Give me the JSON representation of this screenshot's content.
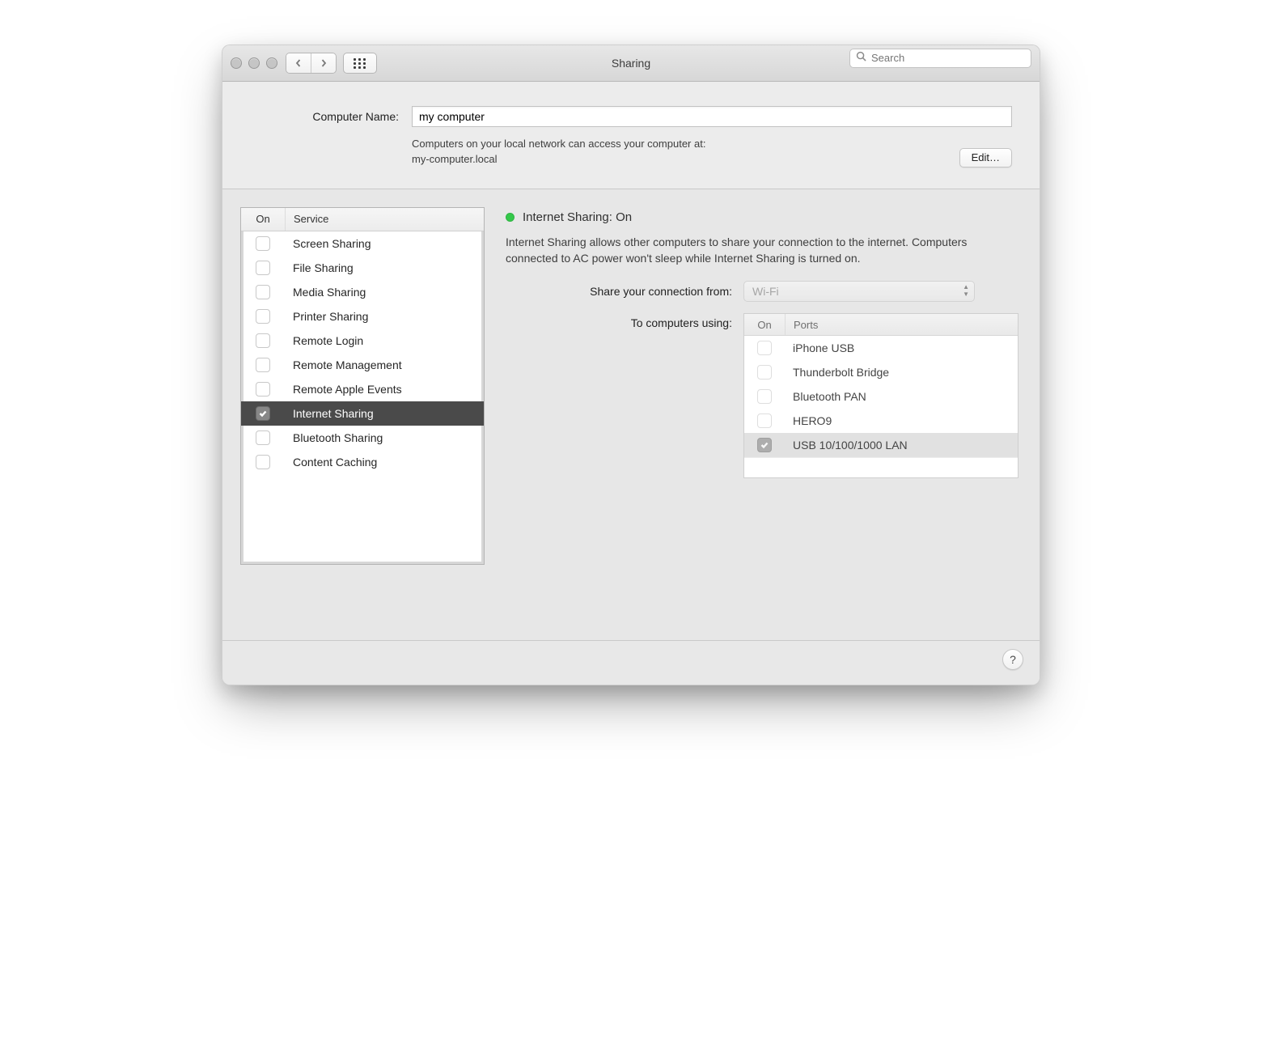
{
  "window": {
    "title": "Sharing"
  },
  "toolbar": {
    "search_placeholder": "Search"
  },
  "computerName": {
    "label": "Computer Name:",
    "value": "my computer",
    "accessLine1": "Computers on your local network can access your computer at:",
    "accessLine2": "my-computer.local",
    "editLabel": "Edit…"
  },
  "servicesHeader": {
    "on": "On",
    "service": "Service"
  },
  "services": [
    {
      "label": "Screen Sharing",
      "on": false,
      "selected": false
    },
    {
      "label": "File Sharing",
      "on": false,
      "selected": false
    },
    {
      "label": "Media Sharing",
      "on": false,
      "selected": false
    },
    {
      "label": "Printer Sharing",
      "on": false,
      "selected": false
    },
    {
      "label": "Remote Login",
      "on": false,
      "selected": false
    },
    {
      "label": "Remote Management",
      "on": false,
      "selected": false
    },
    {
      "label": "Remote Apple Events",
      "on": false,
      "selected": false
    },
    {
      "label": "Internet Sharing",
      "on": true,
      "selected": true
    },
    {
      "label": "Bluetooth Sharing",
      "on": false,
      "selected": false
    },
    {
      "label": "Content Caching",
      "on": false,
      "selected": false
    }
  ],
  "detail": {
    "status": "Internet Sharing: On",
    "description": "Internet Sharing allows other computers to share your connection to the internet. Computers connected to AC power won't sleep while Internet Sharing is turned on.",
    "shareFromLabel": "Share your connection from:",
    "shareFromValue": "Wi-Fi",
    "toComputersLabel": "To computers using:",
    "portsHeader": {
      "on": "On",
      "ports": "Ports"
    },
    "ports": [
      {
        "label": "iPhone USB",
        "on": false,
        "selected": false
      },
      {
        "label": "Thunderbolt Bridge",
        "on": false,
        "selected": false
      },
      {
        "label": "Bluetooth PAN",
        "on": false,
        "selected": false
      },
      {
        "label": "HERO9",
        "on": false,
        "selected": false
      },
      {
        "label": "USB 10/100/1000 LAN",
        "on": true,
        "selected": true
      }
    ]
  }
}
